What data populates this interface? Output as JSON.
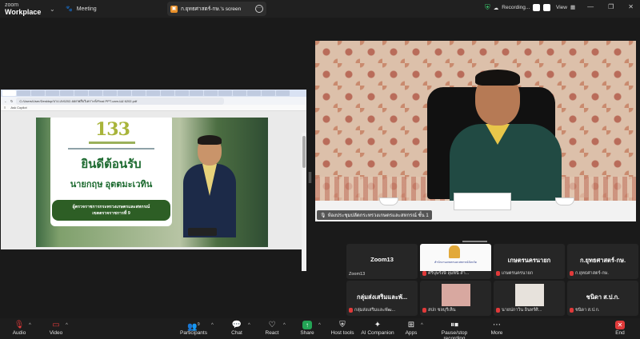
{
  "app": {
    "brand_top": "zoom",
    "brand_bottom": "Workplace",
    "meeting_tab": "Meeting",
    "share_tab": "ก.ยุทธศาสตร์-กษ.'s screen",
    "recording_label": "Recording...",
    "view_label": "View"
  },
  "shared_screen": {
    "url": "C:/Users/User/Desktop/บาง-เก/6202-68/กพสืบวิเคราะห์/Final PPT-cam-แม่ 6202.pdf",
    "pdf_toolbar": "Ask Copilot",
    "slide": {
      "logo": "133",
      "welcome": "ยินดีต้อนรับ",
      "name": "นายกฤษ อุตตมะเวทิน",
      "position_line1": "ผู้ตรวจราชการกระทรวงเกษตรและสหกรณ์",
      "position_line2": "เขตตรวจราชการที่ 9"
    }
  },
  "speaker": {
    "label": "ห้องประชุมปลัดกระทรวงเกษตรและสหกรณ์ ชั้น 1"
  },
  "gallery": {
    "tiles": [
      {
        "title": "Zoom13",
        "sub": "Zoom13",
        "muted": false
      },
      {
        "title": "",
        "sub": "ศรีบุษรังษี ลุมพินี สำ...",
        "muted": true,
        "logo_text": "สำนักงานเกษตรและสหกรณ์จังหวัด"
      },
      {
        "title": "เกษตรนครนายก",
        "sub": "เกษตรนครนายก",
        "muted": true
      },
      {
        "title": "ก.ยุทธศาสตร์-กษ.",
        "sub": "ก.ยุทธศาสตร์-กษ.",
        "muted": true
      },
      {
        "title": "กลุ่มส่งเสริมและพั...",
        "sub": "กลุ่มส่งเสริมและพัฒ...",
        "muted": true
      },
      {
        "title": "",
        "sub": "สปก ชลบุรีเห็น",
        "muted": true
      },
      {
        "title": "",
        "sub": "นายปภาวิน อินทร์ศิ...",
        "muted": true
      },
      {
        "title": "ชนิดา ส.ป.ก.",
        "sub": "ชนิดา ส.ป.ก.",
        "muted": true
      }
    ]
  },
  "toolbar": {
    "audio": "Audio",
    "video": "Video",
    "participants": "Participants",
    "participants_count": "9",
    "chat": "Chat",
    "react": "React",
    "share": "Share",
    "host_tools": "Host tools",
    "ai_companion": "AI Companion",
    "apps": "Apps",
    "pause_recording": "Pause/stop recording",
    "more": "More",
    "end": "End"
  }
}
